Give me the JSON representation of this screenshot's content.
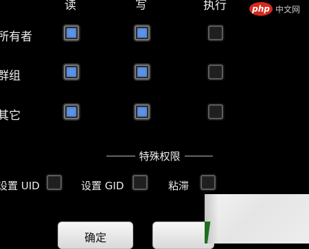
{
  "headers": {
    "read": "读",
    "write": "写",
    "execute": "执行"
  },
  "rows": [
    {
      "label": "所有者",
      "read": true,
      "write": true,
      "execute": false
    },
    {
      "label": "群组",
      "read": true,
      "write": true,
      "execute": false
    },
    {
      "label": "其它",
      "read": true,
      "write": true,
      "execute": false
    }
  ],
  "special": {
    "title": "特殊权限",
    "setuid_label": "设置 UID",
    "setgid_label": "设置 GID",
    "sticky_label": "粘滞",
    "setuid": false,
    "setgid": false,
    "sticky": false
  },
  "buttons": {
    "ok_label": "确定"
  },
  "watermark": {
    "logo": "php",
    "site": "中文网"
  },
  "colors": {
    "checked": "#5b93e8",
    "background": "#000000"
  }
}
